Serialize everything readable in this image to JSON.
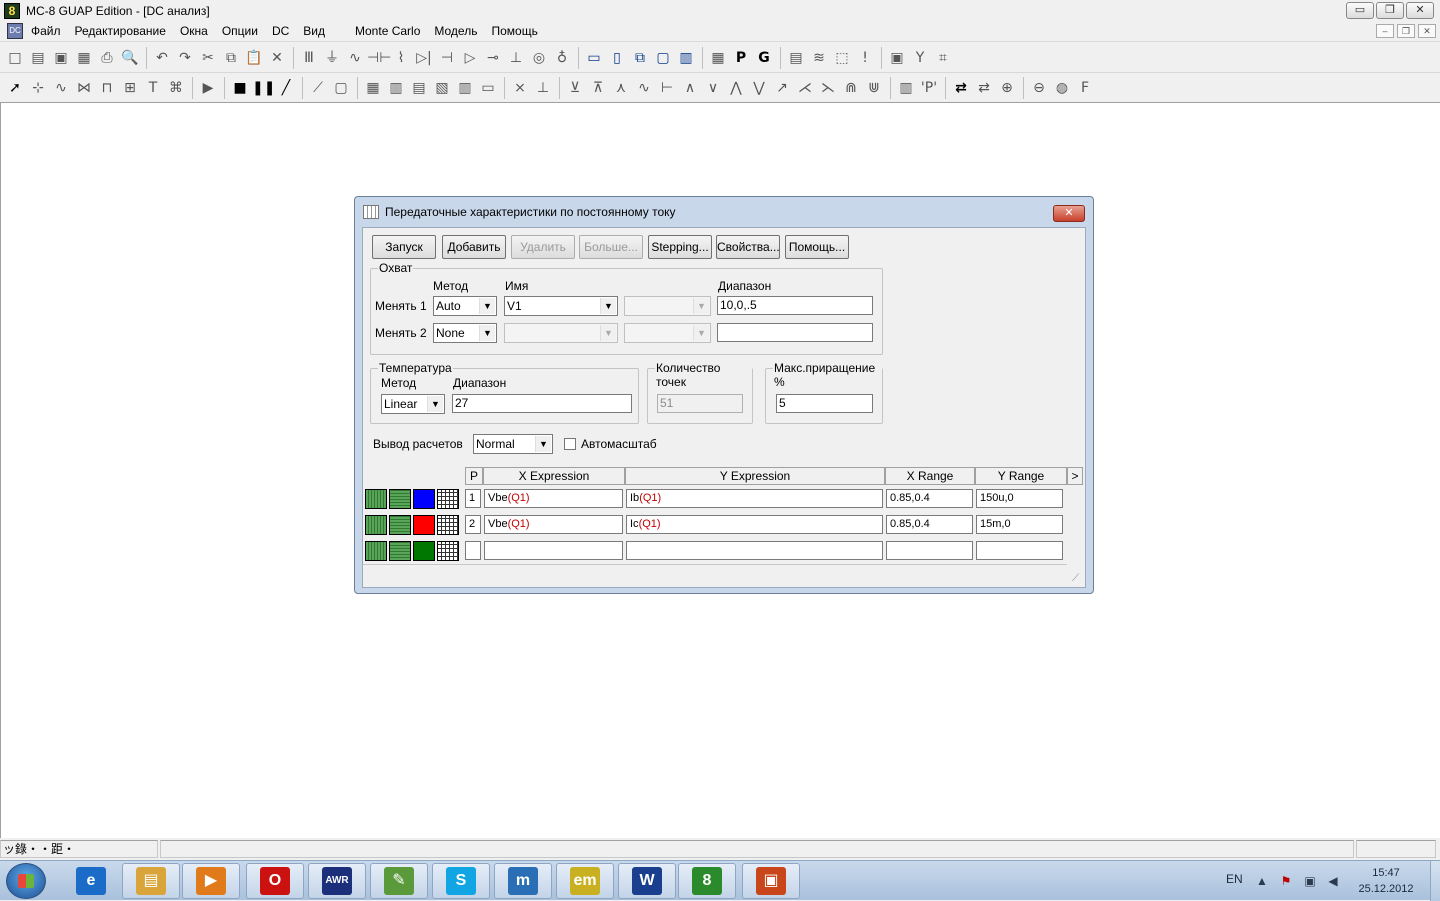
{
  "app": {
    "title": "MC-8 GUAP Edition - [DC анализ]",
    "icon_glyph": "8",
    "window_buttons": [
      "▭",
      "❐",
      "✕"
    ]
  },
  "menu": {
    "icon_glyph": "DC",
    "items": [
      "Файл",
      "Редактирование",
      "Окна",
      "Опции",
      "DC",
      "Вид",
      "Monte Carlo",
      "Модель",
      "Помощь"
    ],
    "mdi_buttons": [
      "–",
      "❐",
      "✕"
    ]
  },
  "toolbar1": {
    "icons": [
      "new-file-icon",
      "open-file-icon",
      "save-icon",
      "save-all-icon",
      "print-icon",
      "print-preview-icon",
      "undo-icon",
      "redo-icon",
      "cut-icon",
      "copy-icon",
      "paste-icon",
      "delete-icon",
      "component-icon",
      "ground-icon",
      "wire-icon",
      "capacitor-icon",
      "inductor-icon",
      "diode-icon",
      "transistor-icon",
      "opamp-icon",
      "switch-icon",
      "battery-icon",
      "source-icon",
      "current-source-icon",
      "split-horizontal-icon",
      "split-vertical-icon",
      "cascade-icon",
      "window-icon",
      "tile-icon",
      "calculator-icon",
      "p-icon",
      "g-icon",
      "table-icon",
      "waveform-icon",
      "probe-icon",
      "info-icon",
      "scope-icon",
      "label-icon",
      "zoom-window-icon"
    ],
    "glyphs": [
      "□",
      "▤",
      "▣",
      "▦",
      "⎙",
      "🔍",
      "↶",
      "↷",
      "✂",
      "⧉",
      "📋",
      "✕",
      "Ⅲ",
      "⏚",
      "∿",
      "⊣⊢",
      "⌇",
      "▷|",
      "⊣",
      "▷",
      "⊸",
      "⊥",
      "◎",
      "♁",
      "▭",
      "▯",
      "⧉",
      "▢",
      "▥",
      "▦",
      "P",
      "G",
      "▤",
      "≋",
      "⬚",
      "!",
      "▣",
      "Y",
      "⌗"
    ]
  },
  "toolbar2": {
    "icons": [
      "select-arrow-icon",
      "component-mode-icon",
      "wire-mode-icon",
      "bus-icon",
      "text-mode-icon",
      "grid-text-icon",
      "tile-icon",
      "text-icon",
      "properties-icon",
      "run-icon",
      "stop-icon",
      "pause-icon",
      "line-icon",
      "diagonal-icon",
      "box-icon",
      "grid-icon",
      "bars-icon",
      "hbars-icon",
      "columns-icon",
      "vbars-icon",
      "flat-icon",
      "cross-icon",
      "cursor-icon",
      "peak-icon",
      "valley-icon",
      "slope-icon",
      "horizontal-icon",
      "vertical-icon",
      "hi-icon",
      "lo-icon",
      "max-icon",
      "min-icon",
      "inflection-icon",
      "global-high-icon",
      "global-low-icon",
      "top-icon",
      "bottom-icon",
      "table-icon",
      "p-label-icon",
      "tag-icon",
      "tag2-icon",
      "zoom-in-icon",
      "zoom-out-icon",
      "globe-icon",
      "f-icon"
    ],
    "glyphs": [
      "➚",
      "⊹",
      "∿",
      "⋈",
      "⊓",
      "⊞",
      "T",
      "⌘",
      "▶",
      "■",
      "❚❚",
      "╱",
      "⟋",
      "▢",
      "▦",
      "▥",
      "▤",
      "▧",
      "▥",
      "▭",
      "⨯",
      "⊥",
      "⊻",
      "⊼",
      "⋏",
      "∿",
      "⊢",
      "∧",
      "∨",
      "⋀",
      "⋁",
      "↗",
      "⋌",
      "⋋",
      "⋒",
      "⋓",
      "▥",
      "'P'",
      "⇄",
      "⇄",
      "⊕",
      "⊖",
      "◍",
      "F"
    ]
  },
  "statusbar": {
    "cells": [
      "ッ錄・・距・",
      "",
      ""
    ]
  },
  "dialog": {
    "title": "Передаточные характеристики по постоянному току",
    "close": "✕",
    "buttons": {
      "run": "Запуск",
      "add": "Добавить",
      "delete": "Удалить",
      "more": "Больше...",
      "stepping": "Stepping...",
      "properties": "Свойства...",
      "help": "Помощь..."
    },
    "sweep": {
      "group": "Охват",
      "method_label": "Метод",
      "name_label": "Имя",
      "range_label": "Диапазон",
      "var1_label": "Менять 1",
      "var1_method": "Auto",
      "var1_name": "V1",
      "var1_extra": "",
      "var1_range": "10,0,.5",
      "var2_label": "Менять 2",
      "var2_method": "None",
      "var2_name": "",
      "var2_extra": "",
      "var2_range": ""
    },
    "temperature": {
      "group": "Температура",
      "method_label": "Метод",
      "range_label": "Диапазон",
      "method": "Linear",
      "range": "27"
    },
    "points": {
      "group": "Количество точек",
      "value": "51"
    },
    "max_change": {
      "group": "Макс.приращение %",
      "value": "5"
    },
    "output": {
      "label": "Вывод  расчетов",
      "value": "Normal",
      "autoscale_label": "Автомасштаб",
      "autoscale_checked": false
    },
    "grid": {
      "headers": {
        "p": "P",
        "x": "X Expression",
        "y": "Y Expression",
        "xr": "X Range",
        "yr": "Y Range",
        "more": ">"
      },
      "rows": [
        {
          "p": "1",
          "x_pre": "Vbe",
          "x_arg": "(Q1)",
          "y_pre": "Ib",
          "y_arg": "(Q1)",
          "xr": "0.85,0.4",
          "yr": "150u,0",
          "color": "#0000ff"
        },
        {
          "p": "2",
          "x_pre": "Vbe",
          "x_arg": "(Q1)",
          "y_pre": "Ic",
          "y_arg": "(Q1)",
          "xr": "0.85,0.4",
          "yr": "15m,0",
          "color": "#ff0000"
        },
        {
          "p": "",
          "x_pre": "",
          "x_arg": "",
          "y_pre": "",
          "y_arg": "",
          "xr": "",
          "yr": "",
          "color": "#007700"
        }
      ]
    }
  },
  "taskbar": {
    "lang": "EN",
    "time": "15:47",
    "date": "25.12.2012",
    "apps": [
      {
        "name": "ie",
        "glyph": "e",
        "color": "#1b6cc9"
      },
      {
        "name": "explorer",
        "glyph": "▤",
        "color": "#d9a53a"
      },
      {
        "name": "media-player",
        "glyph": "▶",
        "color": "#e07a1a"
      },
      {
        "name": "opera",
        "glyph": "O",
        "color": "#cc1111"
      },
      {
        "name": "awr",
        "glyph": "AWR",
        "color": "#1b2f7a"
      },
      {
        "name": "notepad",
        "glyph": "✎",
        "color": "#5a9a3a"
      },
      {
        "name": "skype",
        "glyph": "S",
        "color": "#12a5e3"
      },
      {
        "name": "mathcad",
        "glyph": "m",
        "color": "#2a6fb5"
      },
      {
        "name": "em",
        "glyph": "em",
        "color": "#c8b020"
      },
      {
        "name": "word",
        "glyph": "W",
        "color": "#1a3f8f"
      },
      {
        "name": "microcap",
        "glyph": "8",
        "color": "#2b8a2b"
      },
      {
        "name": "powerpoint",
        "glyph": "▣",
        "color": "#c8461a"
      }
    ]
  }
}
